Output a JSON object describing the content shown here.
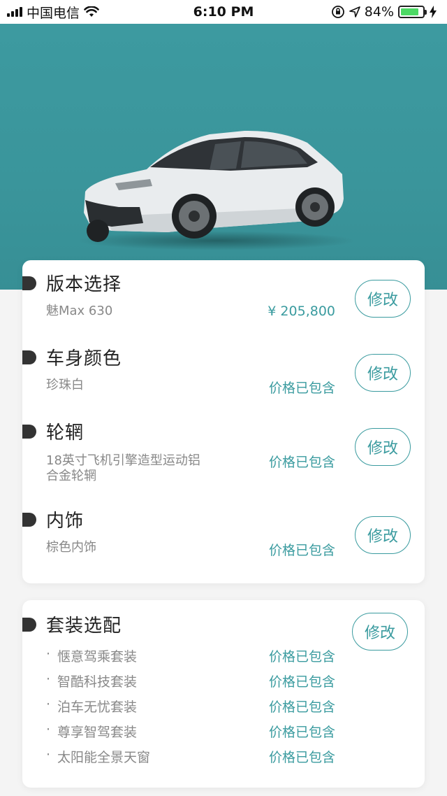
{
  "status_bar": {
    "carrier": "中国电信",
    "time": "6:10 PM",
    "battery_percent": "84%",
    "battery_level": 0.84,
    "icons": [
      "signal-icon",
      "wifi-icon",
      "orientation-lock-icon",
      "location-icon",
      "battery-icon",
      "charging-icon"
    ]
  },
  "hero": {
    "image": "white-sedan-car",
    "background_color": "#3d9aa0"
  },
  "sections": [
    {
      "title": "版本选择",
      "sub": "魅Max 630",
      "price": "¥ 205,800",
      "edit_label": "修改"
    },
    {
      "title": "车身颜色",
      "sub": "珍珠白",
      "price": "价格已包含",
      "edit_label": "修改"
    },
    {
      "title": "轮辋",
      "sub": "18英寸飞机引擎造型运动铝合金轮辋",
      "price": "价格已包含",
      "edit_label": "修改"
    },
    {
      "title": "内饰",
      "sub": "棕色内饰",
      "price": "价格已包含",
      "edit_label": "修改"
    }
  ],
  "packages": {
    "title": "套装选配",
    "edit_label": "修改",
    "items": [
      {
        "bullet": "·",
        "name": "惬意驾乘套装",
        "price": "价格已包含"
      },
      {
        "bullet": "·",
        "name": "智酷科技套装",
        "price": "价格已包含"
      },
      {
        "bullet": "·",
        "name": "泊车无忧套装",
        "price": "价格已包含"
      },
      {
        "bullet": "·",
        "name": "尊享智驾套装",
        "price": "价格已包含"
      },
      {
        "bullet": "·",
        "name": "太阳能全景天窗",
        "price": "价格已包含"
      }
    ]
  },
  "colors": {
    "accent": "#3a9b9f",
    "hero_bg": "#3d9aa0"
  }
}
